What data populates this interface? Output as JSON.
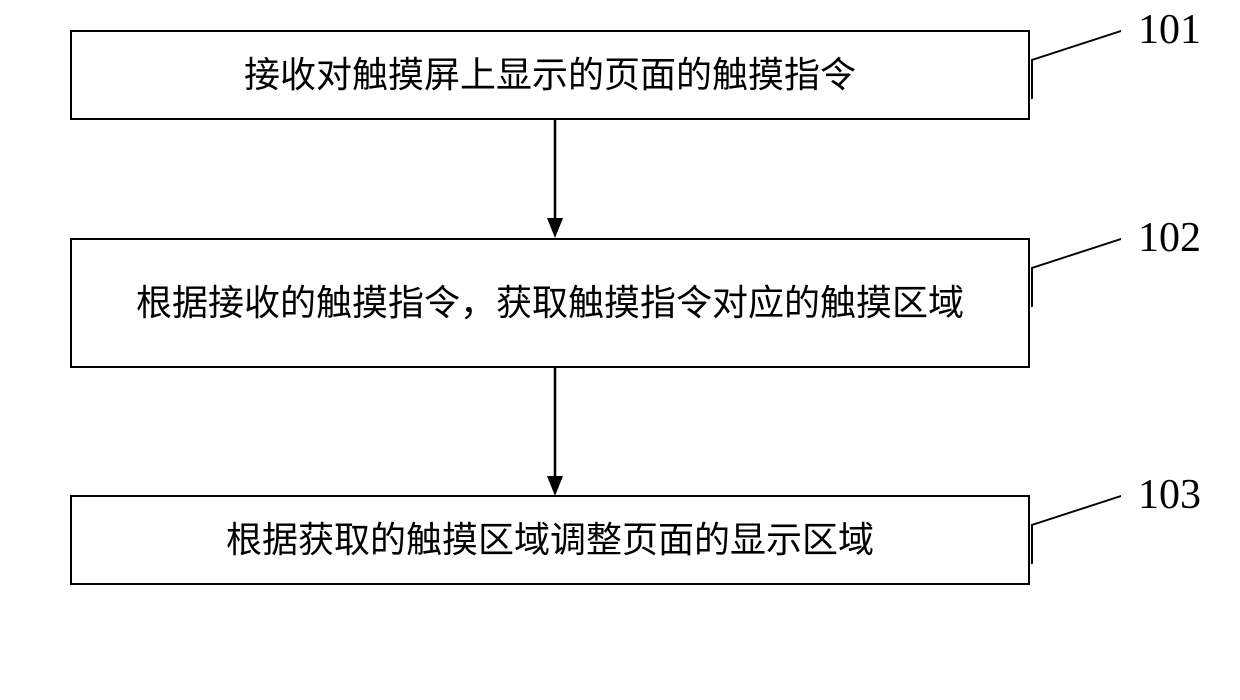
{
  "nodes": {
    "n101": {
      "text": "接收对触摸屏上显示的页面的触摸指令",
      "label": "101"
    },
    "n102": {
      "text": "根据接收的触摸指令，获取触摸指令对应的触摸区域",
      "label": "102"
    },
    "n103": {
      "text": "根据获取的触摸区域调整页面的显示区域",
      "label": "103"
    }
  }
}
